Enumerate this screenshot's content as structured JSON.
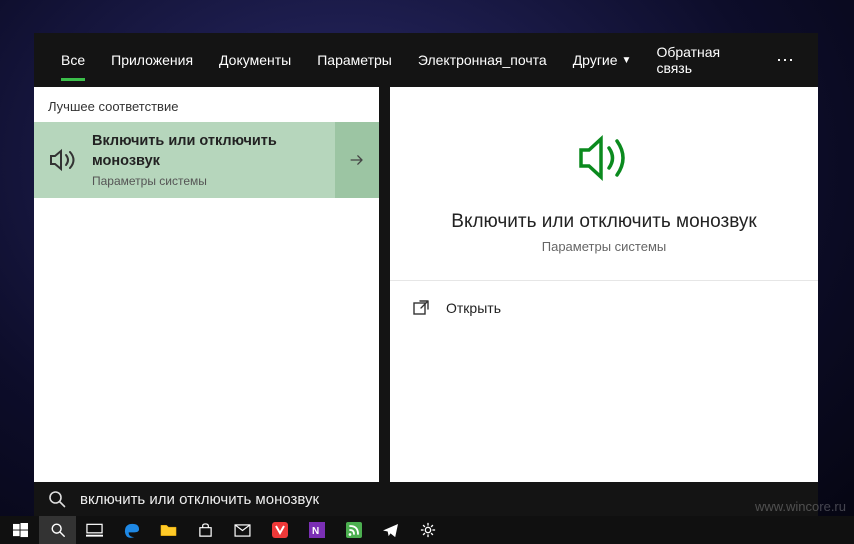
{
  "tabs": {
    "all": "Все",
    "apps": "Приложения",
    "docs": "Документы",
    "settings": "Параметры",
    "email": "Электронная_почта",
    "other": "Другие"
  },
  "feedback": "Обратная связь",
  "section_label": "Лучшее соответствие",
  "result": {
    "title": "Включить или отключить монозвук",
    "subtitle": "Параметры системы"
  },
  "preview": {
    "title": "Включить или отключить монозвук",
    "subtitle": "Параметры системы"
  },
  "action_open": "Открыть",
  "search_query": "включить или отключить монозвук",
  "watermark": "www.wincore.ru"
}
